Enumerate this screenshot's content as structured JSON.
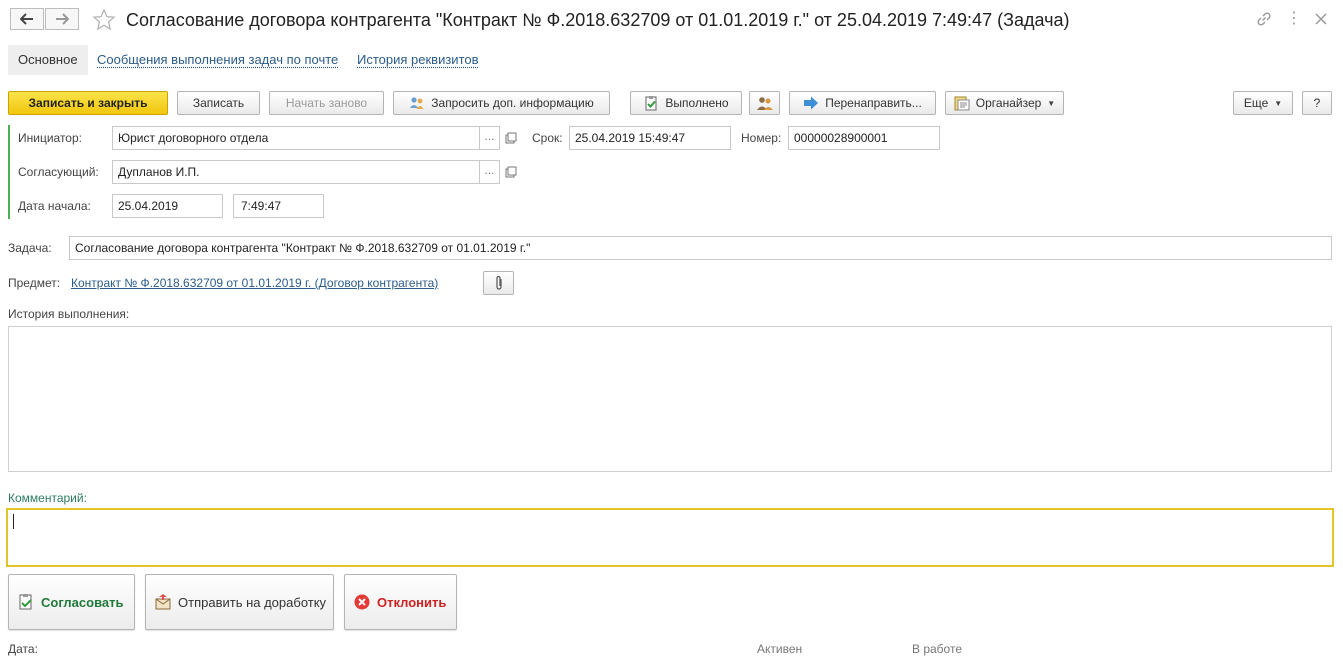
{
  "window": {
    "title": "Согласование договора контрагента \"Контракт № Ф.2018.632709 от 01.01.2019 г.\" от 25.04.2019 7:49:47 (Задача)"
  },
  "tabs": [
    {
      "label": "Основное"
    },
    {
      "label": "Сообщения выполнения задач по почте"
    },
    {
      "label": "История реквизитов"
    }
  ],
  "toolbar": {
    "save_close": "Записать и закрыть",
    "save": "Записать",
    "restart": "Начать заново",
    "request_info": "Запросить доп. информацию",
    "done": "Выполнено",
    "redirect": "Перенаправить...",
    "organizer": "Органайзер",
    "more": "Еще",
    "help": "?"
  },
  "form": {
    "initiator_label": "Инициатор:",
    "initiator_value": "Юрист договорного отдела",
    "deadline_label": "Срок:",
    "deadline_value": "25.04.2019 15:49:47",
    "number_label": "Номер:",
    "number_value": "00000028900001",
    "approver_label": "Согласующий:",
    "approver_value": "Дупланов И.П.",
    "start_label": "Дата начала:",
    "start_date": "25.04.2019",
    "start_time": "7:49:47",
    "task_label": "Задача:",
    "task_value": "Согласование договора контрагента \"Контракт № Ф.2018.632709 от 01.01.2019 г.\"",
    "subject_label": "Предмет:",
    "subject_link": "Контракт № Ф.2018.632709 от 01.01.2019 г. (Договор контрагента)",
    "history_label": "История выполнения:",
    "comment_label": "Комментарий:",
    "comment_value": ""
  },
  "actions": {
    "approve": "Согласовать",
    "send_back": "Отправить на доработку",
    "reject": "Отклонить"
  },
  "footer": {
    "date_label": "Дата:",
    "status_active": "Активен",
    "status_in_work": "В работе"
  },
  "colors": {
    "primary": "#f5d01e",
    "accent_green": "#4caf50",
    "comment_label": "#2e7d5b",
    "comment_border": "#e2c32a",
    "link": "#2b5c8a",
    "reject_red": "#cc2222",
    "approve_green": "#1f7a3a"
  }
}
